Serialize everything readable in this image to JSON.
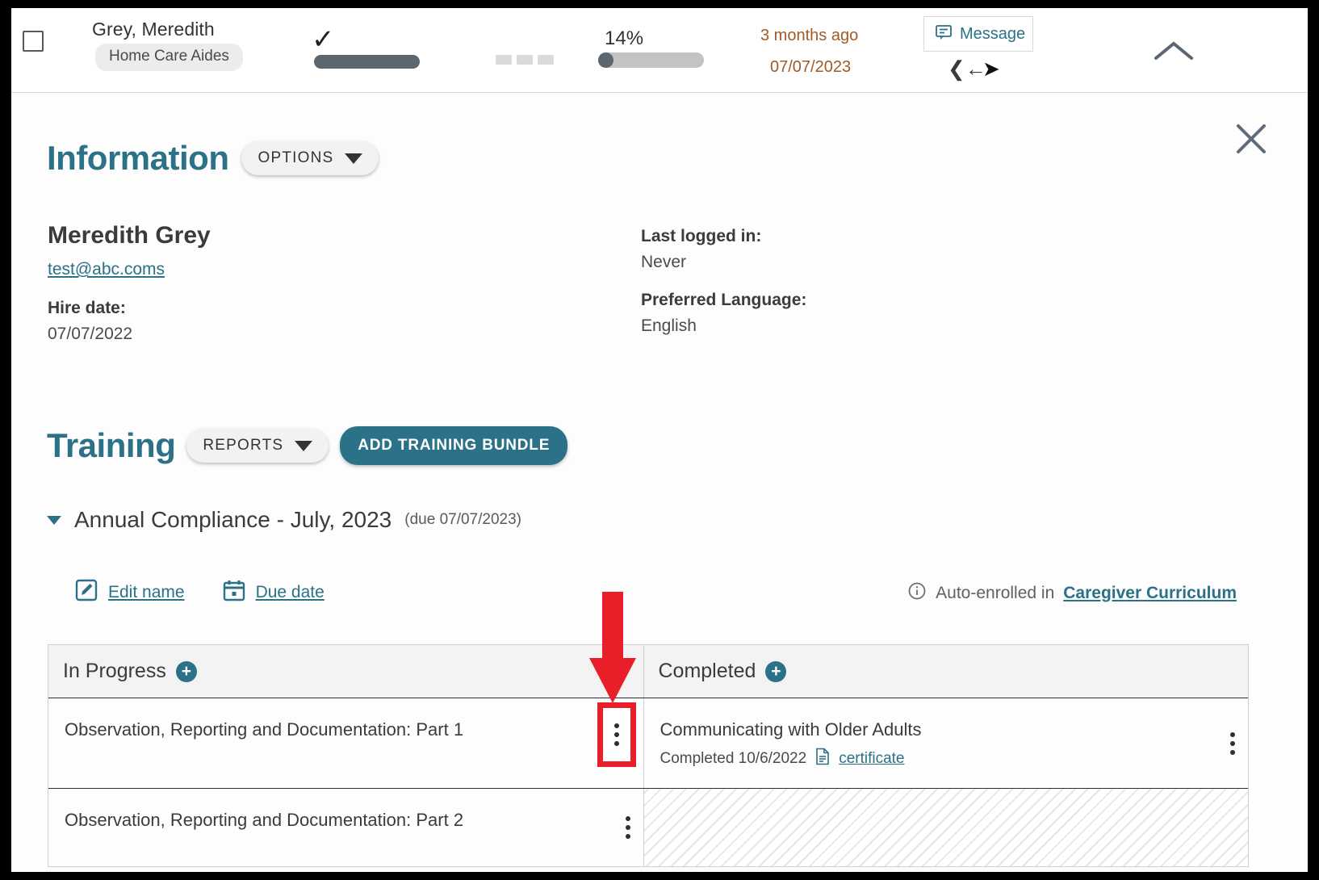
{
  "header": {
    "person_name": "Grey, Meredith",
    "role_badge": "Home Care Aides",
    "check_icon": "checkmark-icon",
    "progress_percent": "14%",
    "relative_time": "3 months ago",
    "due_date": "07/07/2023",
    "message_label": "Message",
    "message_icon": "message-icon",
    "reply_icon": "reply-icon",
    "send_icon": "send-icon",
    "collapse_icon": "chevron-up-icon",
    "checkbox_icon": "checkbox-unchecked-icon",
    "accent_orange": "#a05a28",
    "bar_dark": "#5c666e"
  },
  "close_icon": "close-x-icon",
  "information": {
    "title": "Information",
    "options_label": "OPTIONS",
    "name": "Meredith Grey",
    "email": "test@abc.coms",
    "hire_date_label": "Hire date:",
    "hire_date_value": "07/07/2022",
    "last_logged_in_label": "Last logged in:",
    "last_logged_in_value": "Never",
    "preferred_language_label": "Preferred Language:",
    "preferred_language_value": "English"
  },
  "training": {
    "title": "Training",
    "reports_label": "REPORTS",
    "add_bundle_label": "ADD TRAINING BUNDLE",
    "bundle_title": "Annual Compliance - July, 2023",
    "bundle_due": "(due 07/07/2023)",
    "edit_name_label": "Edit name",
    "due_date_label": "Due date",
    "edit_icon": "edit-pencil-icon",
    "calendar_icon": "calendar-icon",
    "info_icon": "info-circle-icon",
    "auto_enrolled_text": "Auto-enrolled in",
    "auto_enrolled_link": "Caregiver Curriculum",
    "columns": [
      {
        "label": "In Progress",
        "add_icon": "plus-circle-icon"
      },
      {
        "label": "Completed",
        "add_icon": "plus-circle-icon"
      }
    ],
    "rows": [
      {
        "in_progress": "Observation, Reporting and Documentation: Part 1",
        "completed": "Communicating with Older Adults",
        "completed_sub": "Completed 10/6/2022",
        "certificate_label": "certificate",
        "certificate_icon": "document-icon"
      },
      {
        "in_progress": "Observation, Reporting and Documentation: Part 2",
        "completed": "",
        "completed_sub": "",
        "certificate_label": "",
        "certificate_icon": ""
      }
    ],
    "kebab_icon": "more-vertical-icon"
  },
  "annotation": {
    "arrow_icon": "red-down-arrow-annotation",
    "highlight_icon": "red-highlight-box-annotation",
    "color": "#e81f28"
  },
  "theme": {
    "teal": "#2b7187",
    "text": "#3b3b3b"
  }
}
